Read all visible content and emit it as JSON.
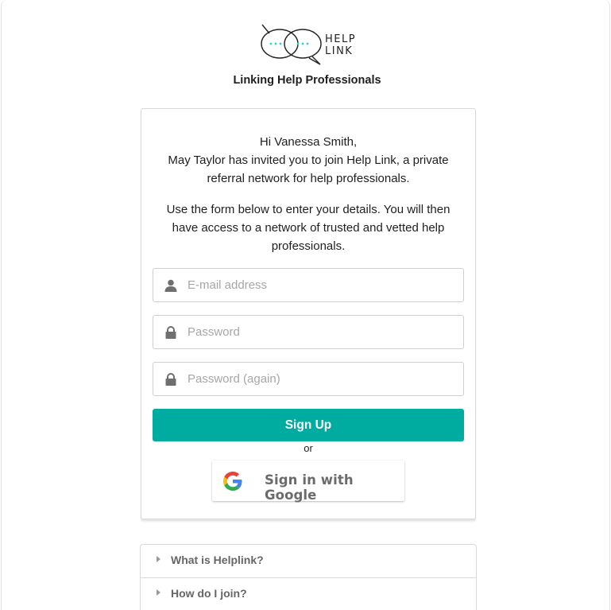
{
  "logo": {
    "line1": "HELP",
    "line2": "LINK"
  },
  "tagline": "Linking Help Professionals",
  "invite": {
    "greeting": "Hi Vanessa Smith,",
    "line2": "May Taylor has invited you to join Help Link, a private",
    "line3": "referral network for help professionals.",
    "para2_line1": "Use the form below to enter your details. You will then",
    "para2_line2": "have access to a network of trusted and vetted help",
    "para2_line3": "professionals."
  },
  "form": {
    "email_placeholder": "E-mail address",
    "password_placeholder": "Password",
    "password_again_placeholder": "Password (again)",
    "signup_label": "Sign Up",
    "or_label": "or",
    "google_label": "Sign in with Google"
  },
  "faq": [
    {
      "question": "What is Helplink?"
    },
    {
      "question": "How do I join?"
    }
  ],
  "colors": {
    "accent": "#00aba0",
    "logo_dots": "#2ad4c8"
  },
  "icons": {
    "email": "user-icon",
    "password": "lock-icon",
    "google": "google-g-icon",
    "faq": "caret-right-icon"
  }
}
